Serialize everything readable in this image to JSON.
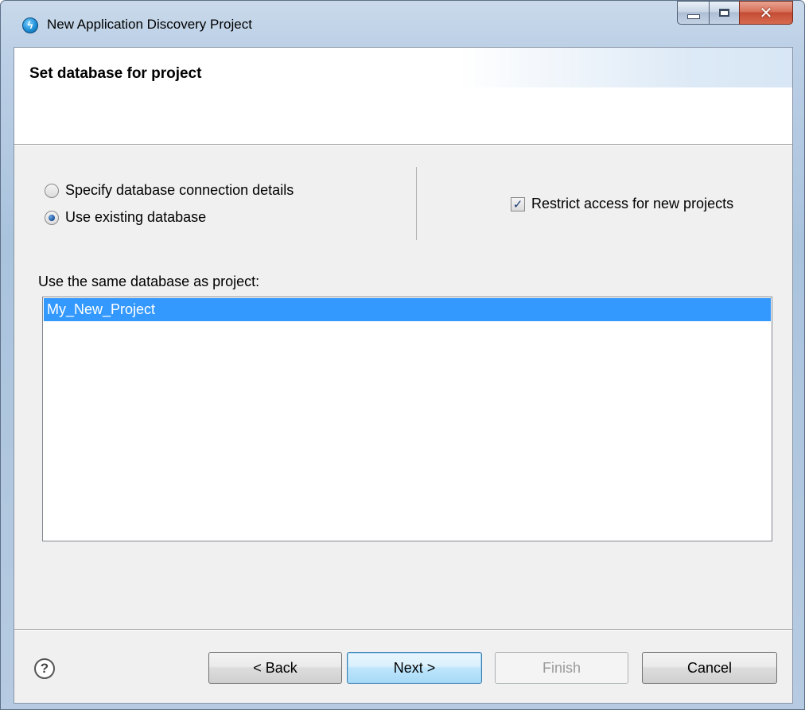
{
  "window": {
    "title": "New Application Discovery Project",
    "app_icon": "eclipse-app-icon"
  },
  "header": {
    "title": "Set database for project"
  },
  "options": {
    "radio_specify_label": "Specify database connection details",
    "radio_specify_checked": false,
    "radio_existing_label": "Use existing database",
    "radio_existing_checked": true,
    "restrict_label": "Restrict access for new projects",
    "restrict_checked": true
  },
  "project_list": {
    "label": "Use the same database as project:",
    "items": [
      "My_New_Project"
    ],
    "selected_index": 0
  },
  "footer": {
    "help_glyph": "?",
    "back_label": "< Back",
    "next_label": "Next >",
    "finish_label": "Finish",
    "cancel_label": "Cancel",
    "finish_enabled": false
  },
  "colors": {
    "selection": "#3399ff",
    "dialog_bg": "#f0f0f0",
    "frame": "#bcd0e6"
  }
}
